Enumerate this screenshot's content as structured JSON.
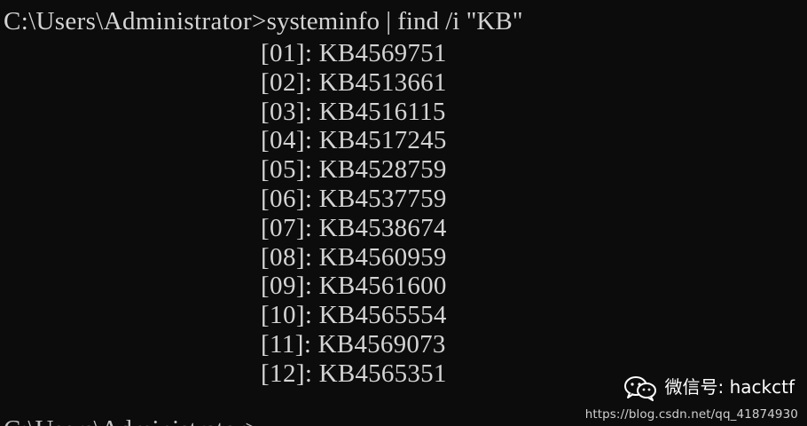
{
  "terminal": {
    "prompt_path": "C:\\Users\\Administrator>",
    "command": "systeminfo | find /i \"KB\"",
    "next_prompt_partial": "C:\\Users\\Administrator>"
  },
  "hotfixes": [
    {
      "index": "[01]:",
      "kb": "KB4569751"
    },
    {
      "index": "[02]:",
      "kb": "KB4513661"
    },
    {
      "index": "[03]:",
      "kb": "KB4516115"
    },
    {
      "index": "[04]:",
      "kb": "KB4517245"
    },
    {
      "index": "[05]:",
      "kb": "KB4528759"
    },
    {
      "index": "[06]:",
      "kb": "KB4537759"
    },
    {
      "index": "[07]:",
      "kb": "KB4538674"
    },
    {
      "index": "[08]:",
      "kb": "KB4560959"
    },
    {
      "index": "[09]:",
      "kb": "KB4561600"
    },
    {
      "index": "[10]:",
      "kb": "KB4565554"
    },
    {
      "index": "[11]:",
      "kb": "KB4569073"
    },
    {
      "index": "[12]:",
      "kb": "KB4565351"
    }
  ],
  "watermark": {
    "account_label": "微信号: hackctf",
    "url": "https://blog.csdn.net/qq_41874930",
    "icon": "wechat-icon"
  },
  "colors": {
    "background": "#0c0c0c",
    "text": "#d4d4d4"
  }
}
